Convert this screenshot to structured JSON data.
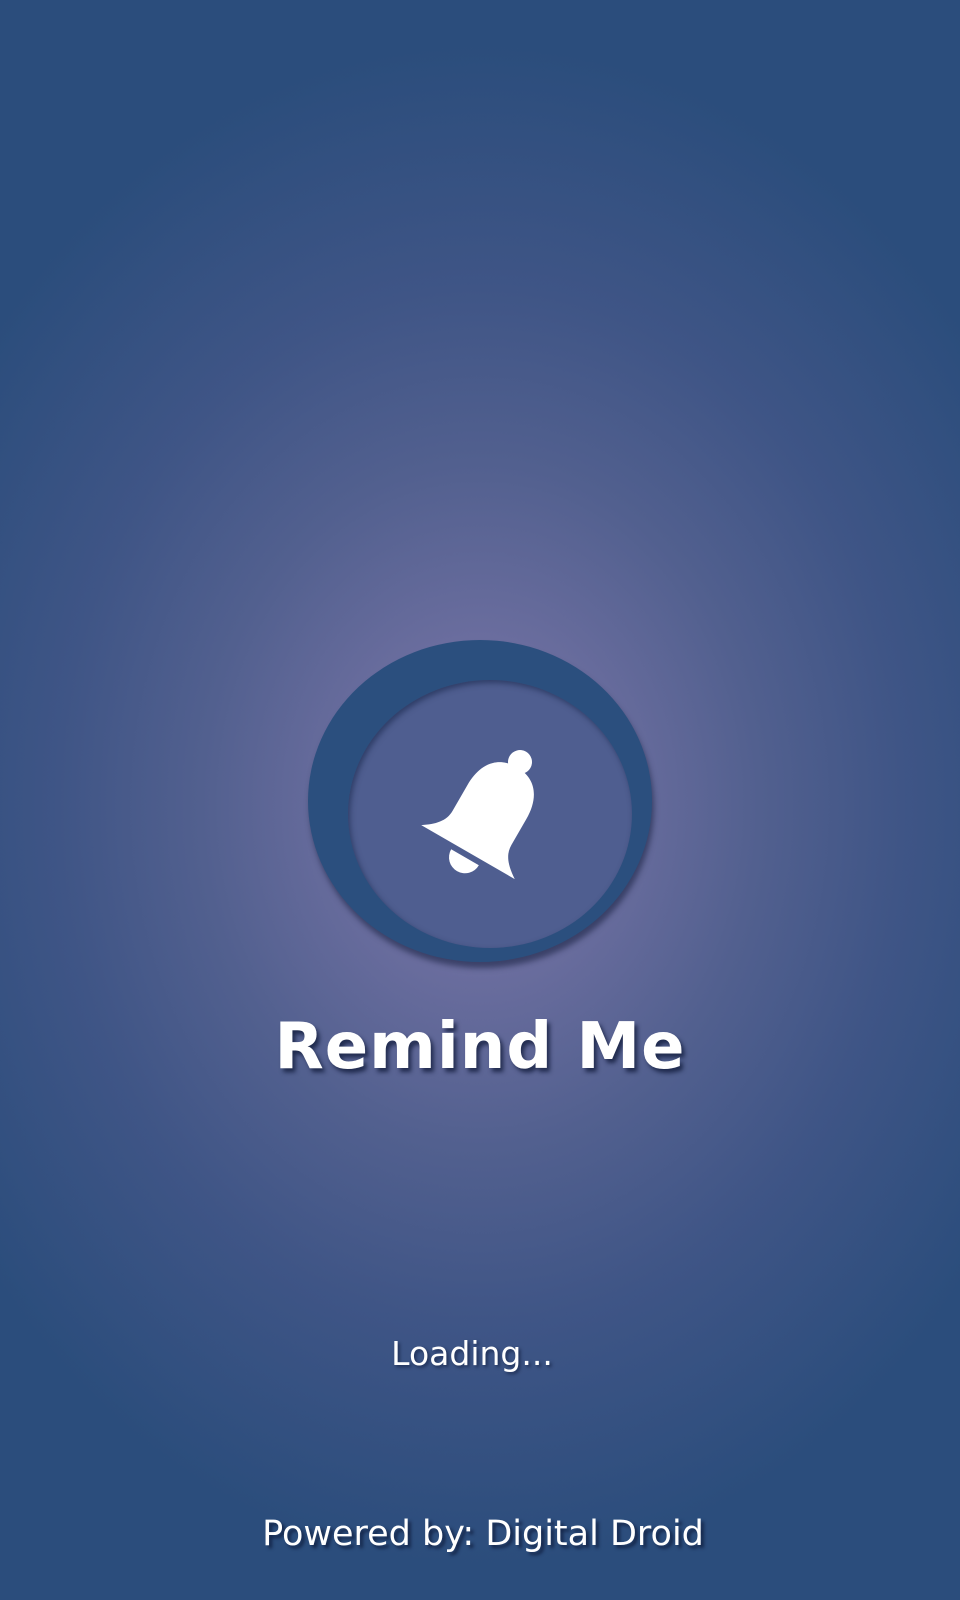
{
  "app": {
    "title": "Remind Me",
    "logo_icon": "bell-icon"
  },
  "status": {
    "loading_text": "Loading..."
  },
  "footer": {
    "powered_by": "Powered by: Digital Droid"
  },
  "colors": {
    "background_center": "#7a77a8",
    "background_edge": "#2b4d7c",
    "logo_ring": "#2b4f7e",
    "logo_disc": "#4f5e90",
    "text": "#ffffff"
  }
}
